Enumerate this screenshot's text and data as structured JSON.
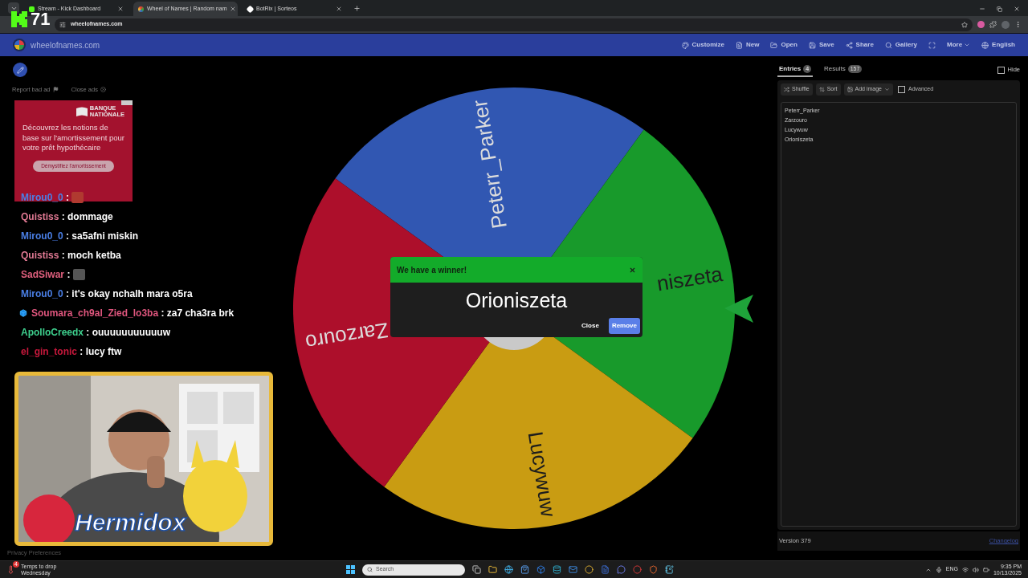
{
  "browser": {
    "tabs": [
      {
        "title": "Stream - Kick Dashboard",
        "selected": false
      },
      {
        "title": "Wheel of Names | Random nam",
        "selected": true
      },
      {
        "title": "BotRix | Sorteos",
        "selected": false
      }
    ],
    "url": "wheelofnames.com"
  },
  "stream_overlay": {
    "viewers": "71",
    "streamer": "Hermidox"
  },
  "site": {
    "name": "wheelofnames.com",
    "menu": [
      {
        "kind": "button",
        "label": "Customize"
      },
      {
        "kind": "button",
        "label": "New"
      },
      {
        "kind": "button",
        "label": "Open"
      },
      {
        "kind": "button",
        "label": "Save"
      },
      {
        "kind": "button",
        "label": "Share"
      },
      {
        "kind": "button",
        "label": "Gallery"
      },
      {
        "kind": "icon"
      },
      {
        "kind": "dropdown",
        "label": "More"
      },
      {
        "kind": "button",
        "label": "English"
      }
    ]
  },
  "ad": {
    "report": "Report bad ad",
    "close": "Close ads",
    "brand": [
      "BANQUE",
      "NATIONALE"
    ],
    "text": "Découvrez les notions de base sur l'amortissement pour votre prêt hypothécaire",
    "cta": "Démystifiez l'amortissement"
  },
  "chat": [
    {
      "user": "Mirou0_0",
      "color": "#4a7fe6",
      "kind": "emote",
      "text": ":",
      "badge": false
    },
    {
      "user": "Quistiss",
      "color": "#e27a94",
      "kind": "text",
      "text": ": dommage",
      "badge": false
    },
    {
      "user": "Mirou0_0",
      "color": "#4a7fe6",
      "kind": "text",
      "text": ": sa5afni miskin",
      "badge": false
    },
    {
      "user": "Quistiss",
      "color": "#e27a94",
      "kind": "text",
      "text": ": moch ketba",
      "badge": false
    },
    {
      "user": "SadSiwar",
      "color": "#e0607e",
      "kind": "emote",
      "text": ":",
      "badge": false
    },
    {
      "user": "Mirou0_0",
      "color": "#4a7fe6",
      "kind": "text",
      "text": ": it's okay nchalh mara o5ra",
      "badge": false
    },
    {
      "user": "Soumara_ch9al_Zied_lo3ba",
      "color": "#e0567e",
      "kind": "text",
      "text": ": za7 cha3ra brk",
      "badge": true
    },
    {
      "user": "ApolloCreedx",
      "color": "#3ed08e",
      "kind": "text",
      "text": ": ouuuuuuuuuuuw",
      "badge": false
    },
    {
      "user": "el_gin_tonic",
      "color": "#c8183c",
      "kind": "text",
      "text": ": lucy ftw",
      "badge": false
    }
  ],
  "wheel": {
    "segments": [
      {
        "label": "Peterr_Parker",
        "color": "#3157b2"
      },
      {
        "label": "niszeta",
        "color": "#189a2b"
      },
      {
        "label": "Lucywuw",
        "color": "#c99c12"
      },
      {
        "label": "Zarzouro",
        "color": "#ad0f2b"
      }
    ]
  },
  "dialog": {
    "title": "We have a winner!",
    "winner": "Orioniszeta",
    "buttons": [
      {
        "label": "Close",
        "primary": false
      },
      {
        "label": "Remove",
        "primary": true
      }
    ]
  },
  "panel": {
    "tabs": [
      {
        "label": "Entries",
        "count": "4",
        "selected": true
      },
      {
        "label": "Results",
        "count": "157",
        "selected": false
      }
    ],
    "hide": {
      "label": "Hide",
      "checked": false
    },
    "tools": [
      {
        "label": "Shuffle",
        "dropdown": false
      },
      {
        "label": "Sort",
        "dropdown": false
      },
      {
        "label": "Add image",
        "dropdown": true
      }
    ],
    "advanced": {
      "label": "Advanced",
      "checked": false
    },
    "entries": [
      "Peterr_Parker",
      "Zarzouro",
      "Lucywuw",
      "Orioniszeta"
    ],
    "version": "Version 379",
    "changelog": "Changelog"
  },
  "footer": {
    "privacy": "Privacy Preferences"
  },
  "taskbar": {
    "weather": {
      "title": "Temps to drop",
      "subtitle": "Wednesday",
      "badge": "4"
    },
    "search": "Search",
    "language": "ENG",
    "time": "9:35 PM",
    "date": "10/13/2025"
  }
}
